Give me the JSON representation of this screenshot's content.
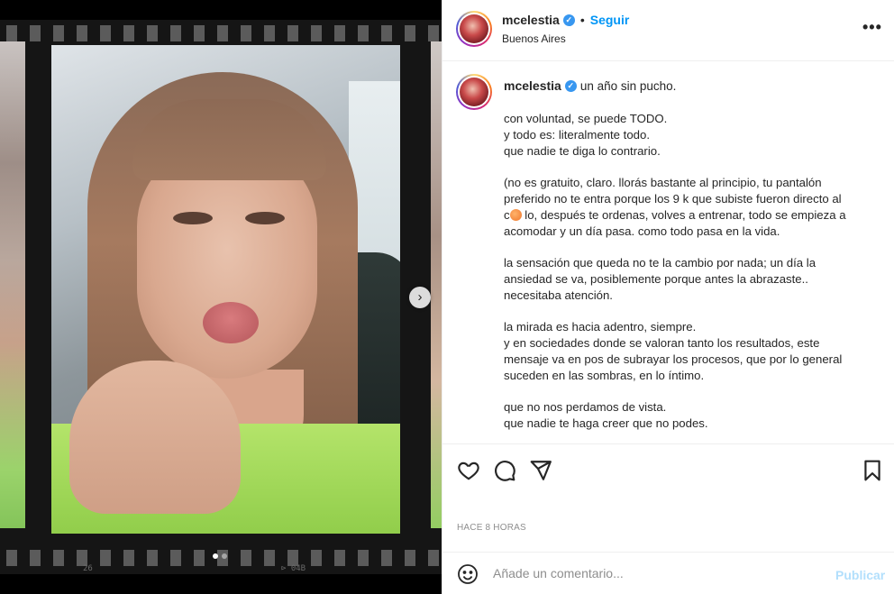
{
  "post": {
    "username": "mcelestia",
    "follow_label": "Seguir",
    "location": "Buenos Aires",
    "more_label": "•••",
    "next_label": "›",
    "film_marks": [
      "26",
      "⊳ 04B"
    ],
    "carousel": {
      "count": 2,
      "active_index": 0
    }
  },
  "caption": {
    "username": "mcelestia",
    "first_line": "un año sin pucho.",
    "paragraphs": [
      {
        "lines": [
          "con voluntad, se puede TODO.",
          "y todo es: literalmente todo.",
          "que nadie te diga lo contrario."
        ]
      },
      {
        "lines": [
          "(no es gratuito, claro. llorás bastante al principio, tu pantalón",
          "preferido no te entra porque los 9 k que subiste fueron directo al"
        ],
        "peach_line_before": "c",
        "peach_line_after": "lo, después te ordenas, volves a entrenar, todo se empieza a",
        "last": "acomodar y un día pasa. como todo pasa en la vida."
      },
      {
        "lines": [
          "la sensación que queda no te la cambio por nada; un día la",
          "ansiedad se va, posiblemente porque antes la abrazaste..",
          "necesitaba atención."
        ]
      },
      {
        "lines": [
          "la mirada es hacia adentro, siempre.",
          "y en sociedades donde se valoran tanto los resultados, este",
          "mensaje va en pos de subrayar los procesos, que por lo general",
          "suceden en las sombras, en lo íntimo."
        ]
      },
      {
        "lines": [
          "que no nos perdamos de vista.",
          "que nadie te haga creer que no podes."
        ]
      }
    ]
  },
  "timestamp": "HACE 8 HORAS",
  "comment": {
    "placeholder": "Añade un comentario...",
    "publish_label": "Publicar"
  },
  "colors": {
    "accent": "#0095f6",
    "verified": "#3897f0",
    "publish_disabled": "#b2dffc"
  },
  "icons": [
    "heart-icon",
    "comment-icon",
    "share-icon",
    "bookmark-icon",
    "emoji-icon",
    "verified-badge-icon",
    "more-icon",
    "chevron-right-icon"
  ]
}
